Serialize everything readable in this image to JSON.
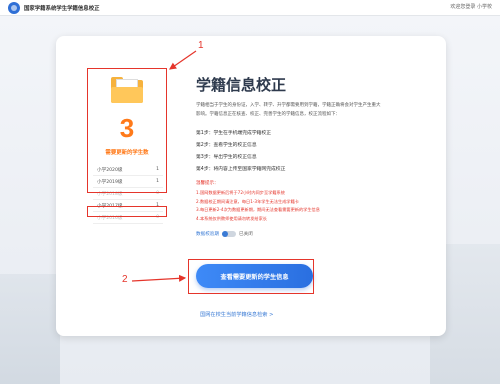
{
  "topbar": {
    "app_title": "国家学籍系统学生学籍信息校正",
    "user_text": "欢迎您登录 小学校"
  },
  "left_panel": {
    "count": "3",
    "count_label": "需要更新的学生数",
    "years": [
      {
        "name": "小学2020级",
        "value": "1"
      },
      {
        "name": "小学2019级",
        "value": "1"
      },
      {
        "name": "小学2018级",
        "value": "0"
      },
      {
        "name": "小学2017级",
        "value": "1"
      },
      {
        "name": "小学2016级",
        "value": "0"
      }
    ]
  },
  "main": {
    "heading": "学籍信息校正",
    "description": "学籍相当于学生的身份证，入学、转学、升学都需要用到学籍，学籍正确将会对学生产生重大影响。学籍信息正在核查、校正、完善学生的学籍信息，校正流程如下：",
    "steps": [
      "第1步：学生在手机端完成学籍校正",
      "第2步：查看学生的校正信息",
      "第3步：导出学生的校正信息",
      "第4步：将内容上传至国家学籍网完成校正"
    ],
    "warn_title": "温馨提示：",
    "warnings": [
      "1.国网数据更新后将于72小时内同步至学籍系统",
      "2.数据校正期间请注意，每日1-3年学生无法生成学籍卡",
      "3.每日更新2-4次为数据更新期，期间无法查看需要更新的学生信息",
      "4.本系统仅供教师使用请勿转发给家长"
    ],
    "toggle_label": "数据校验期",
    "toggle_state": "已关闭",
    "primary_button": "查看需要更新的学生信息",
    "link_text": "国网在校生当前学籍信息检索 >"
  },
  "annotations": {
    "one": "1",
    "two": "2"
  },
  "colors": {
    "accent": "#2a6fe0",
    "highlight": "#ff7a1a",
    "annotation": "#e5352b"
  }
}
